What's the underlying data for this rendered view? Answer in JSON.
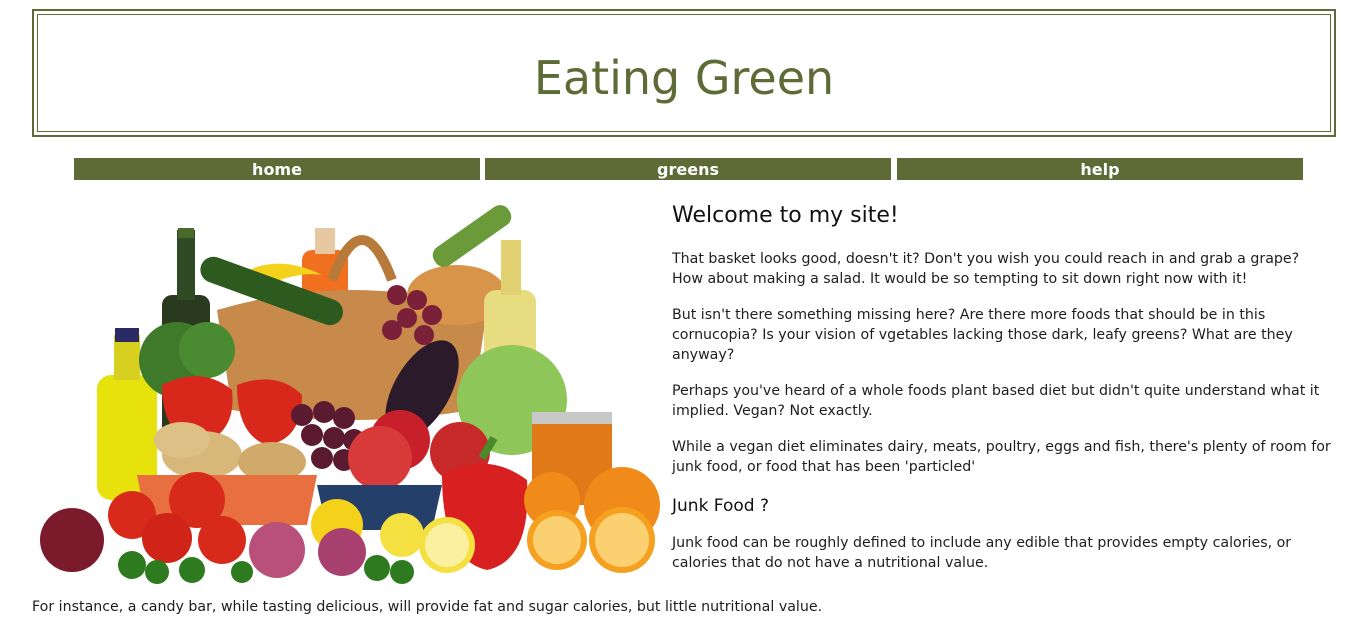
{
  "header": {
    "title": "Eating Green"
  },
  "nav": {
    "items": [
      {
        "label": "home"
      },
      {
        "label": "greens"
      },
      {
        "label": "help"
      }
    ]
  },
  "main": {
    "heading": "Welcome to my site!",
    "paragraphs": [
      "That basket looks good, doesn't it? Don't you wish you could reach in and grab a grape? How about making a salad. It would be so tempting to sit down right now with it!",
      "But isn't there something missing here? Are there more foods that should be in this cornucopia? Is your vision of vgetables lacking those dark, leafy greens? What are they anyway?",
      "Perhaps you've heard of a whole foods plant based diet but didn't quite understand what it implied. Vegan? Not exactly.",
      "While a vegan diet eliminates dairy, meats, poultry, eggs and fish, there's plenty of room for junk food, or food that has been 'particled'"
    ],
    "subheading": "Junk Food ?",
    "junk_paragraph": "Junk food can be roughly defined to include any edible that provides empty calories, or calories that do not have a nutritional value.",
    "bottom_paragraph": "For instance, a candy bar, while tasting delicious, will provide fat and sugar calories, but little nutritional value."
  },
  "colors": {
    "accent": "#5e6b36",
    "nav_text": "#ffffff",
    "body_text": "#1e1e1e"
  }
}
